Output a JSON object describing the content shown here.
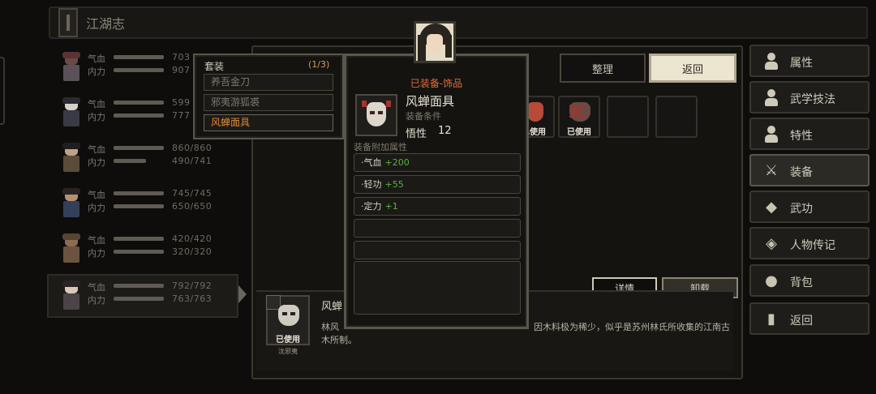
{
  "topbar": {
    "title": "江湖志"
  },
  "characters": [
    {
      "hp_label": "气血",
      "mp_label": "内力",
      "hp": "703",
      "mp": "907"
    },
    {
      "hp_label": "气血",
      "mp_label": "内力",
      "hp": "599",
      "mp": "777"
    },
    {
      "hp_label": "气血",
      "mp_label": "内力",
      "hp": "860/860",
      "mp": "490/741"
    },
    {
      "hp_label": "气血",
      "mp_label": "内力",
      "hp": "745/745",
      "mp": "650/650"
    },
    {
      "hp_label": "气血",
      "mp_label": "内力",
      "hp": "420/420",
      "mp": "320/320"
    },
    {
      "hp_label": "气血",
      "mp_label": "内力",
      "hp": "792/792",
      "mp": "763/763"
    }
  ],
  "set_panel": {
    "title": "套装",
    "count": "(1/3)",
    "items": [
      "养吾金刀",
      "邪夷游狐裘",
      "风蝉面具"
    ]
  },
  "detail": {
    "type": "已装备-饰品",
    "name": "风蝉面具",
    "req_label": "装备条件",
    "stat_name": "悟性",
    "stat_value": "12",
    "bonus_title": "装备附加属性",
    "bonuses": [
      {
        "name": "·气血",
        "value": "+200"
      },
      {
        "name": "·轻功",
        "value": "+55"
      },
      {
        "name": "·定力",
        "value": "+1"
      }
    ]
  },
  "toolbar": {
    "sort": "整理",
    "back": "返回"
  },
  "slots": [
    {
      "used": "已使用",
      "state": "partial"
    },
    {
      "used": "已使用",
      "state": "used"
    },
    {
      "used": "",
      "state": "empty"
    },
    {
      "used": "",
      "state": "empty"
    }
  ],
  "actions": {
    "detail": "详情",
    "unequip": "卸载"
  },
  "item_info": {
    "name": "风蝉",
    "used": "已使用",
    "owner": "沈邪夷",
    "desc_1": "林风",
    "desc_2": "因木料极为稀少，似乎是苏州林氏所收集的江南古",
    "desc_3": "木所制。"
  },
  "side_menu": [
    {
      "label": "属性",
      "icon": "person-icon"
    },
    {
      "label": "武学技法",
      "icon": "martial-person-icon"
    },
    {
      "label": "特性",
      "icon": "trait-person-icon"
    },
    {
      "label": "装备",
      "icon": "sword-icon"
    },
    {
      "label": "武功",
      "icon": "scroll-icon"
    },
    {
      "label": "人物传记",
      "icon": "book-icon"
    },
    {
      "label": "背包",
      "icon": "bag-icon"
    },
    {
      "label": "返回",
      "icon": "exit-door-icon"
    }
  ],
  "colors": {
    "accent_orange": "#e08a2a",
    "equip_type_red": "#e06c3a",
    "bonus_green": "#58b43a",
    "count_gold": "#d4a040"
  }
}
